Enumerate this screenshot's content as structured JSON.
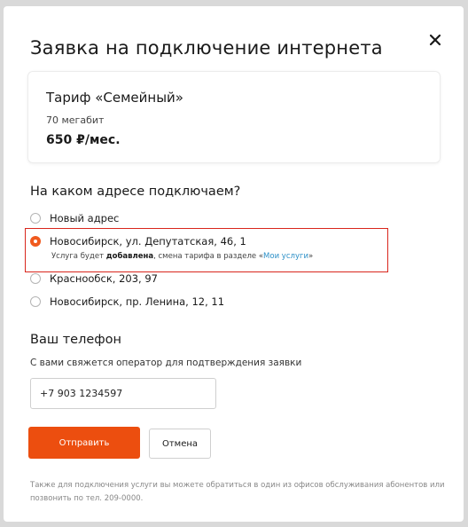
{
  "modal": {
    "title": "Заявка на подключение интернета",
    "close_icon": "close-icon"
  },
  "tariff": {
    "name": "Тариф «Семейный»",
    "speed": "70 мегабит",
    "price": "650 ₽/мес."
  },
  "address": {
    "title": "На каком адресе подключаем?",
    "options": [
      {
        "label": "Новый адрес",
        "checked": false
      },
      {
        "label": "Новосибирск, ул. Депутатская, 46, 1",
        "checked": true
      },
      {
        "label": "Краснообск, 203, 97",
        "checked": false
      },
      {
        "label": "Новосибирск, пр. Ленина, 12, 11",
        "checked": false
      }
    ],
    "note": {
      "prefix": "Услуга будет ",
      "bold": "добавлена",
      "middle": ", смена тарифа в разделе «",
      "link": "Мои услуги",
      "suffix": "»"
    }
  },
  "phone": {
    "title": "Ваш телефон",
    "description": "С вами свяжется оператор для подтверждения заявки",
    "value": "+7 903 1234597"
  },
  "buttons": {
    "submit": "Отправить",
    "cancel": "Отмена"
  },
  "footer": {
    "text": "Также для подключения услуги вы можете обратиться в один из офисов обслуживания абонентов или позвонить по тел. 209-0000."
  },
  "colors": {
    "accent": "#ec4e0f",
    "highlight_border": "#d9261c",
    "link": "#2b8fc7"
  }
}
